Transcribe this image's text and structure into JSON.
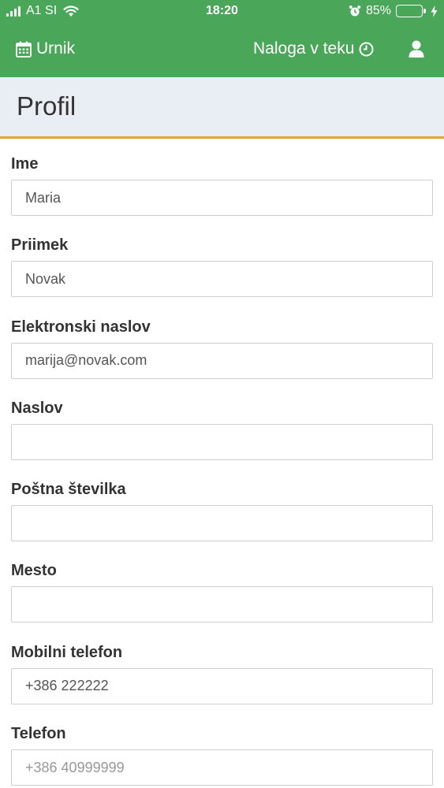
{
  "status_bar": {
    "carrier": "A1 SI",
    "time": "18:20",
    "battery": "85%",
    "battery_level": 0.85
  },
  "nav": {
    "brand_label": "Urnik",
    "brand_icon": "calendar-icon",
    "tasks_label": "Naloga v teku",
    "tasks_icon": "clock-icon",
    "user_icon": "user-icon"
  },
  "page": {
    "title": "Profil"
  },
  "form": {
    "fields": [
      {
        "label": "Ime",
        "value": "Maria",
        "placeholder": ""
      },
      {
        "label": "Priimek",
        "value": "Novak",
        "placeholder": ""
      },
      {
        "label": "Elektronski naslov",
        "value": "marija@novak.com",
        "placeholder": ""
      },
      {
        "label": "Naslov",
        "value": "",
        "placeholder": ""
      },
      {
        "label": "Poštna številka",
        "value": "",
        "placeholder": ""
      },
      {
        "label": "Mesto",
        "value": "",
        "placeholder": ""
      },
      {
        "label": "Mobilni telefon",
        "value": "+386 222222",
        "placeholder": ""
      },
      {
        "label": "Telefon",
        "value": "",
        "placeholder": "+386 40999999"
      }
    ]
  },
  "colors": {
    "navbar": "#4aa658",
    "header_bg": "#e9eef5",
    "header_accent": "#e8a033"
  }
}
